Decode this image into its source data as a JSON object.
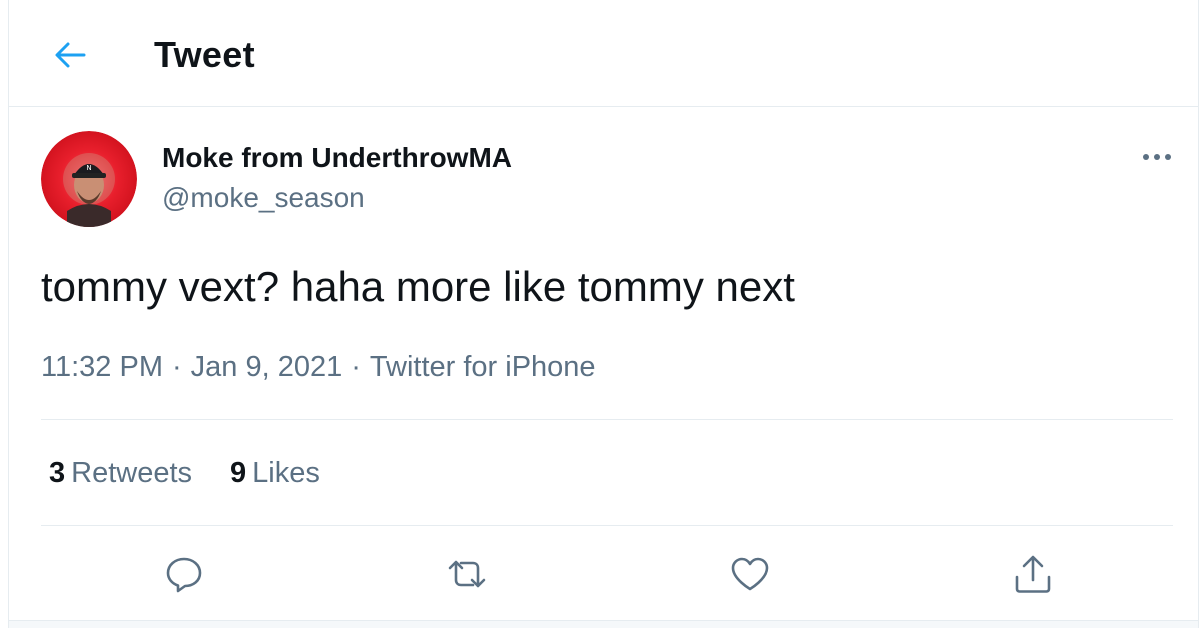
{
  "header": {
    "title": "Tweet",
    "back_icon": "arrow-left-icon"
  },
  "author": {
    "display_name": "Moke from UnderthrowMA",
    "handle": "@moke_season",
    "avatar_icon": "avatar-photo"
  },
  "tweet": {
    "text": "tommy vext? haha more like tommy next",
    "time": "11:32 PM",
    "date": "Jan 9, 2021",
    "source": "Twitter for iPhone",
    "separator": "·"
  },
  "stats": {
    "retweets_count": "3",
    "retweets_label": "Retweets",
    "likes_count": "9",
    "likes_label": "Likes"
  },
  "actions": [
    {
      "name": "reply",
      "icon": "reply-icon"
    },
    {
      "name": "retweet",
      "icon": "retweet-icon"
    },
    {
      "name": "like",
      "icon": "heart-icon"
    },
    {
      "name": "share",
      "icon": "share-icon"
    }
  ],
  "colors": {
    "accent": "#1da1f2",
    "text_primary": "#0f1419",
    "text_secondary": "#5b7083",
    "border": "#e6ecf0",
    "avatar_ring": "#e0202a"
  }
}
